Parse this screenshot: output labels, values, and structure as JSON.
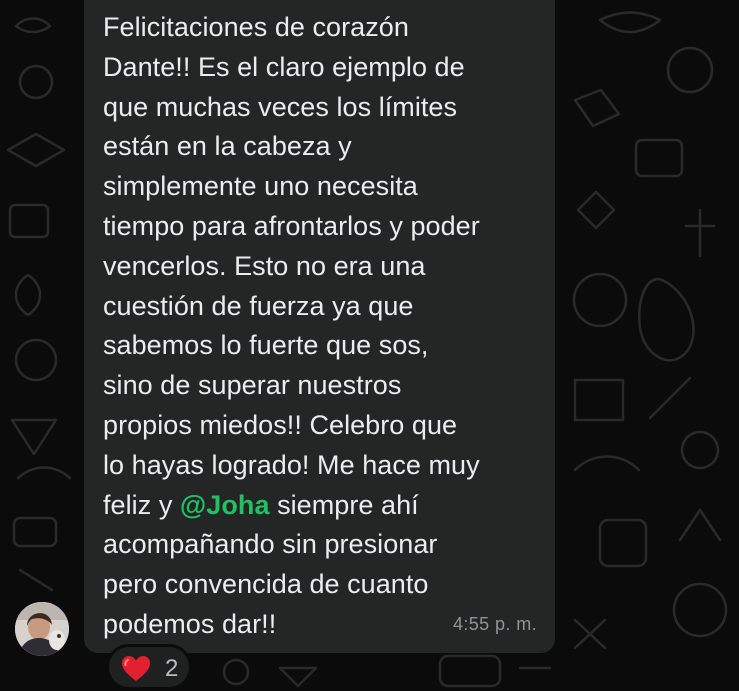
{
  "message": {
    "lines": [
      "Felicitaciones de corazón",
      "Dante!! Es el claro ejemplo de",
      "que muchas veces los límites",
      "están en la cabeza y",
      "simplemente uno necesita",
      "tiempo para afrontarlos y poder",
      "vencerlos. Esto no era una",
      "cuestión de fuerza ya que",
      "sabemos lo fuerte que sos,",
      "sino de superar nuestros",
      "propios miedos!! Celebro que",
      "lo hayas logrado! Me hace muy"
    ],
    "mention_line": {
      "before": "feliz y ",
      "mention": "@Joha",
      "after": " siempre ahí"
    },
    "final_lines": [
      "acompañando sin presionar",
      "pero convencida de cuanto",
      "podemos dar!!"
    ],
    "timestamp": "4:55 p. m."
  },
  "reaction": {
    "emoji_icon": "red-heart-icon",
    "count": "2"
  },
  "colors": {
    "background": "#0b0b0b",
    "bubble": "#242626",
    "text": "#e9edef",
    "mention": "#21c063",
    "timestamp": "#8d9598",
    "heart": "#e2202f"
  }
}
